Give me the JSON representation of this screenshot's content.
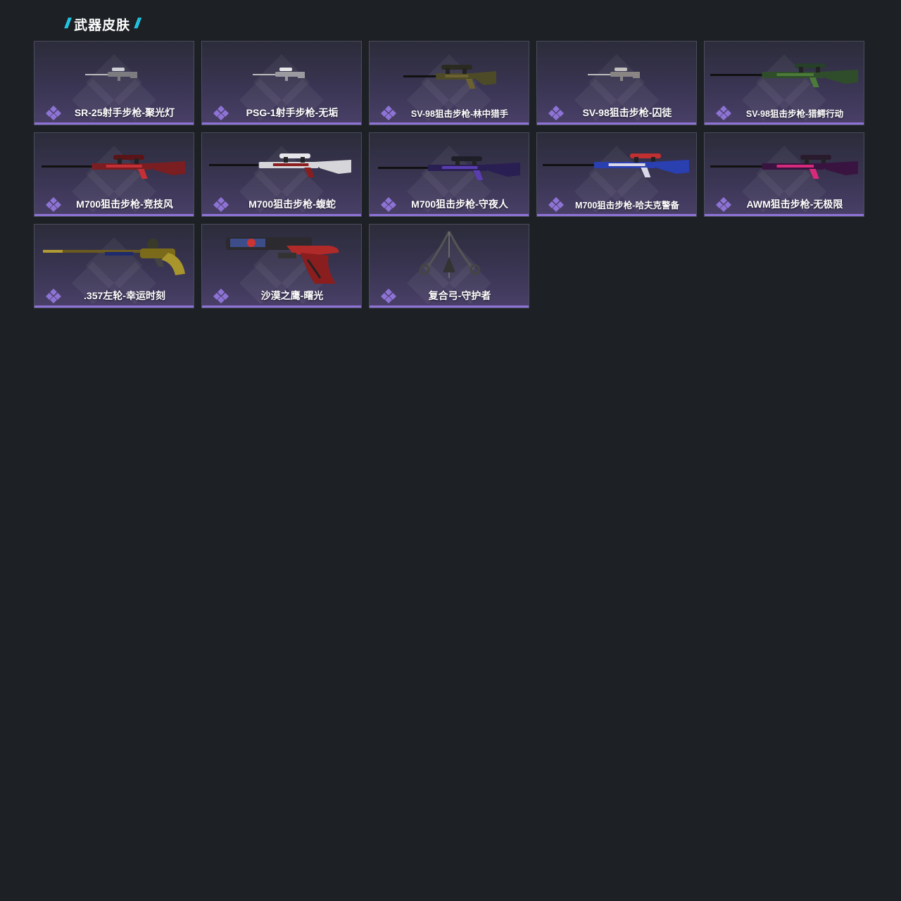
{
  "section": {
    "title": "武器皮肤"
  },
  "colors": {
    "background": "#1d2025",
    "accent_cyan": "#1fd0ef",
    "rarity_purple": "#8e73d6"
  },
  "skins": [
    {
      "name": "SR-25射手步枪-聚光灯",
      "weapon_icon": "marksman-rifle-grey",
      "rarity": "epic"
    },
    {
      "name": "PSG-1射手步枪-无垢",
      "weapon_icon": "marksman-rifle-white",
      "rarity": "epic"
    },
    {
      "name": "SV-98狙击步枪-林中猎手",
      "weapon_icon": "sniper-rifle-camo",
      "rarity": "epic"
    },
    {
      "name": "SV-98狙击步枪-囚徒",
      "weapon_icon": "sniper-rifle-grey",
      "rarity": "epic"
    },
    {
      "name": "SV-98狙击步枪-猎鳄行动",
      "weapon_icon": "sniper-rifle-green",
      "rarity": "epic"
    },
    {
      "name": "M700狙击步枪-竞技风",
      "weapon_icon": "sniper-rifle-red",
      "rarity": "epic"
    },
    {
      "name": "M700狙击步枪-蝮蛇",
      "weapon_icon": "sniper-rifle-white",
      "rarity": "epic"
    },
    {
      "name": "M700狙击步枪-守夜人",
      "weapon_icon": "sniper-rifle-purple",
      "rarity": "epic"
    },
    {
      "name": "M700狙击步枪-哈夫克警备",
      "weapon_icon": "sniper-rifle-blue",
      "rarity": "epic"
    },
    {
      "name": "AWM狙击步枪-无极限",
      "weapon_icon": "sniper-rifle-pink",
      "rarity": "epic"
    },
    {
      "name": ".357左轮-幸运时刻",
      "weapon_icon": "revolver-gold",
      "rarity": "epic"
    },
    {
      "name": "沙漠之鹰-曙光",
      "weapon_icon": "pistol-red",
      "rarity": "epic"
    },
    {
      "name": "复合弓-守护者",
      "weapon_icon": "compound-bow",
      "rarity": "epic"
    }
  ]
}
